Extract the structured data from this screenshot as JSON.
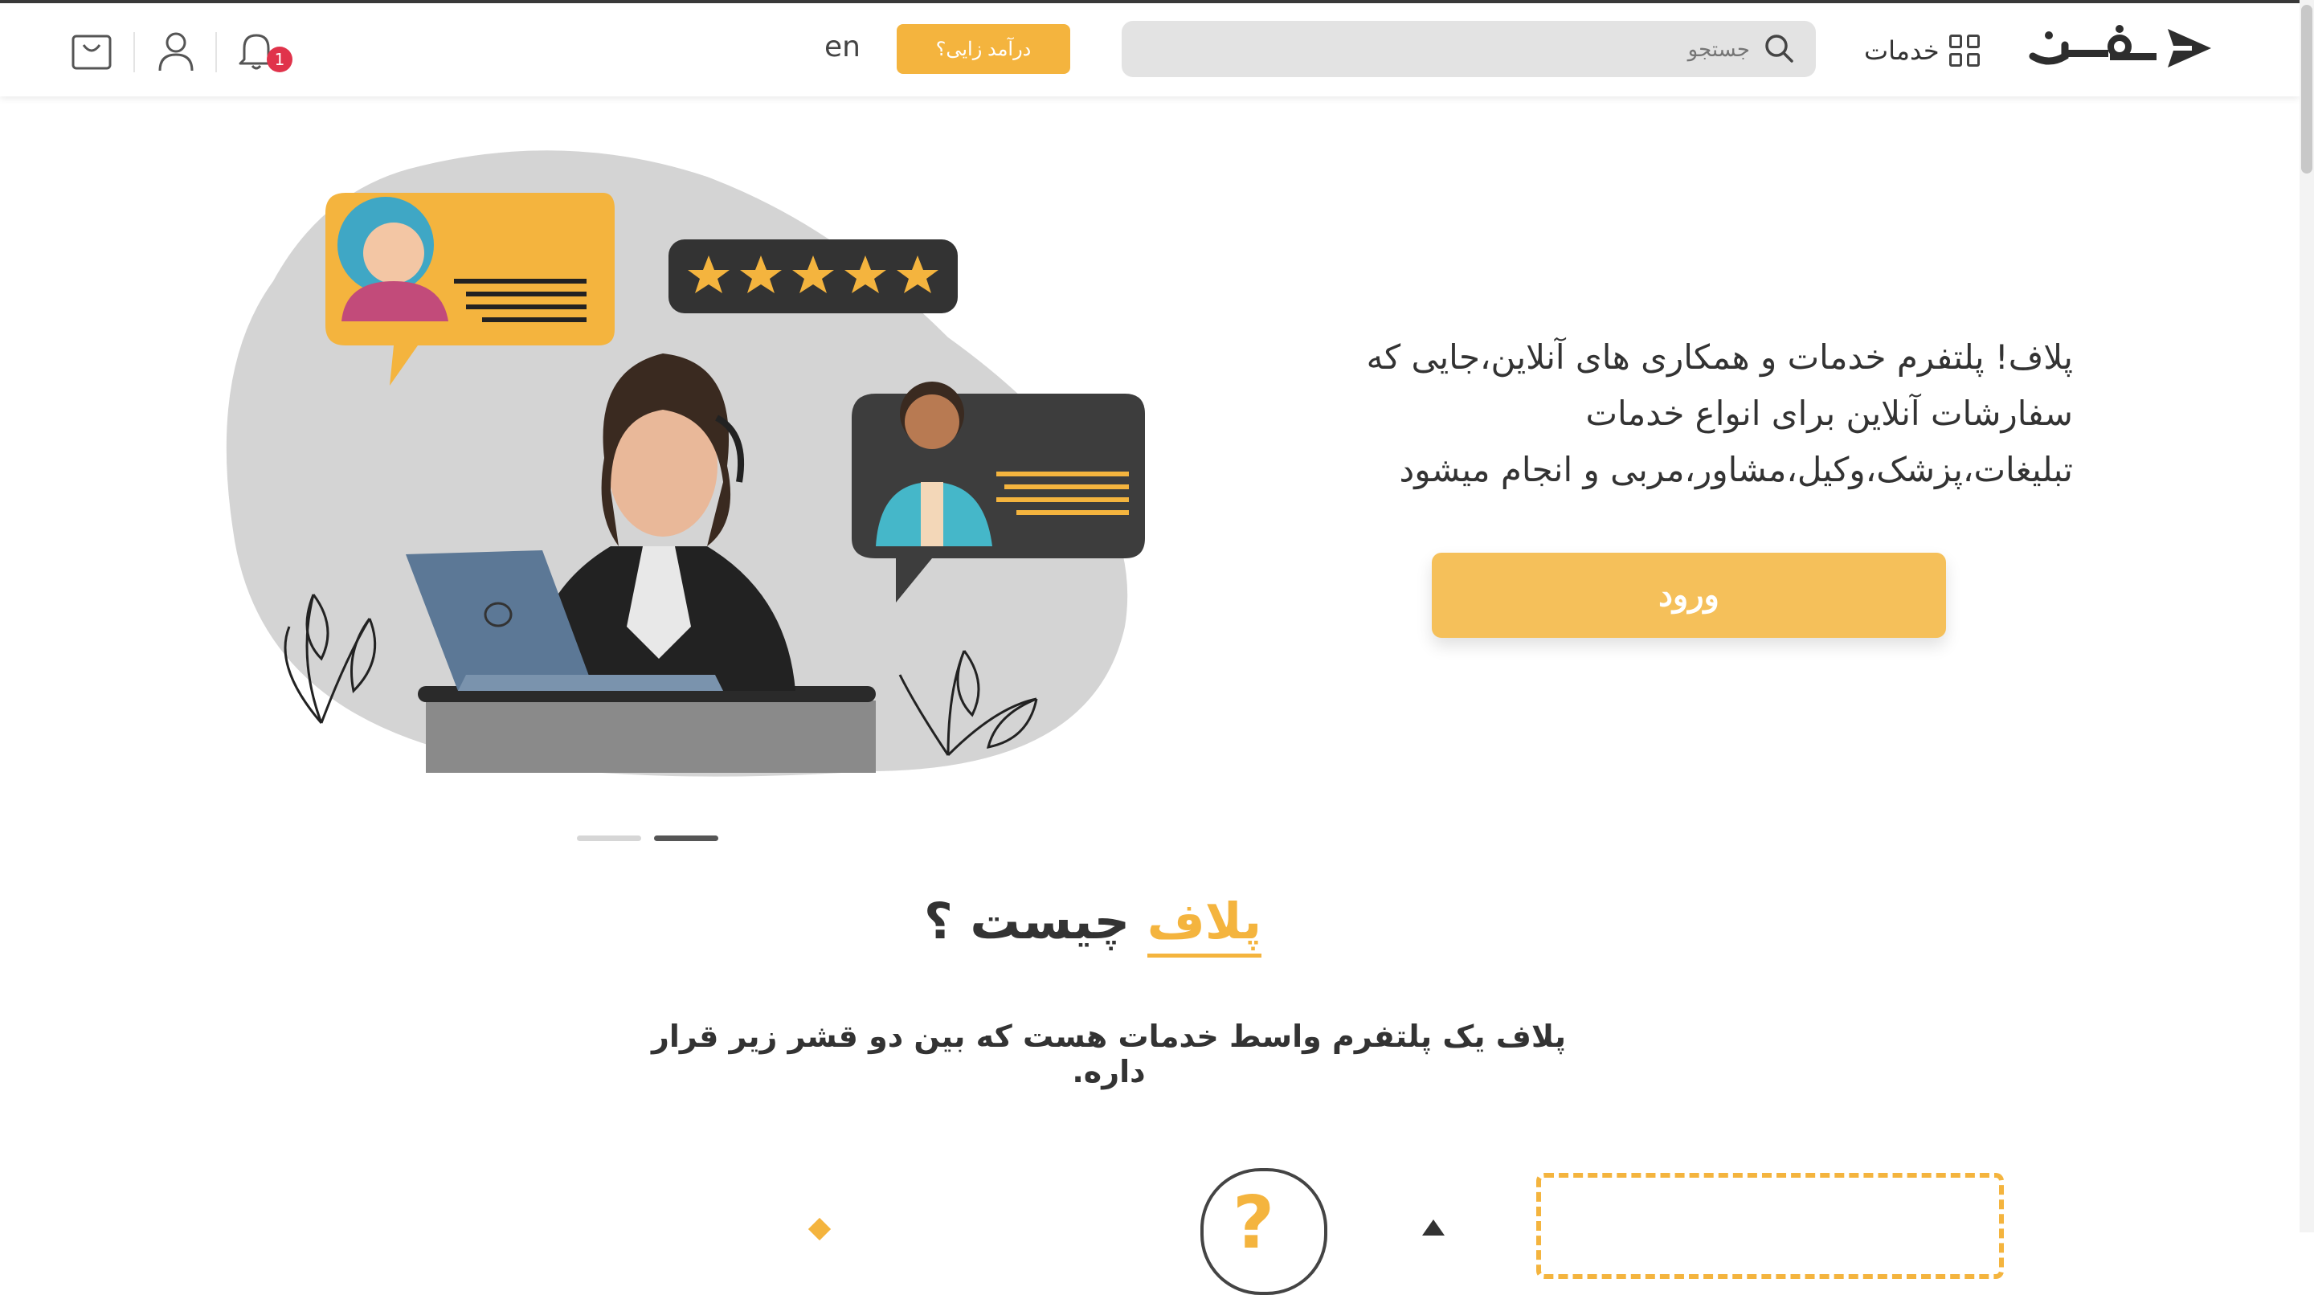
{
  "header": {
    "logo_text": "فــوز",
    "services_label": "خدمات",
    "search_placeholder": "جستجو",
    "income_button": "درآمد زایی؟",
    "language": "en",
    "notification_count": "1"
  },
  "hero": {
    "line1": "پلاف! پلتفرم خدمات و همکاری های آنلاین،جایی که",
    "line2": "سفارشات آنلاین برای انواع خدمات",
    "line3": "تبلیغات،پزشک،وکیل،مشاور،مربی و انجام میشود",
    "login_button": "ورود"
  },
  "about": {
    "title_highlight": "پلاف",
    "title_rest": " چیست ؟",
    "description": "پلاف یک پلتفرم واسط خدمات هست که بین دو قشر زیر قرار داره."
  },
  "colors": {
    "accent": "#f4b43e",
    "badge": "#e0334b",
    "dark": "#3a3a3a"
  }
}
